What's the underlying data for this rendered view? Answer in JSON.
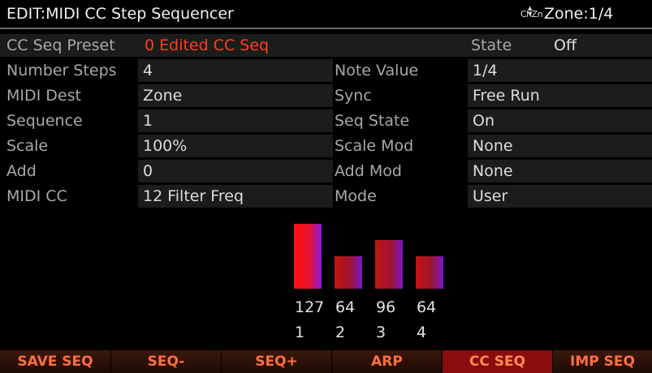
{
  "header": {
    "title": "EDIT:MIDI CC Step Sequencer",
    "channel_zone_icon_text": "ChZn",
    "zone": "Zone:1/4"
  },
  "params": {
    "preset_label": "CC Seq Preset",
    "preset_value": "0 Edited CC Seq",
    "state_label": "State",
    "state_value": "Off",
    "left": [
      {
        "label": "Number Steps",
        "value": "4"
      },
      {
        "label": "MIDI Dest",
        "value": "Zone"
      },
      {
        "label": "Sequence",
        "value": "1"
      },
      {
        "label": "Scale",
        "value": "100%"
      },
      {
        "label": "Add",
        "value": "0"
      },
      {
        "label": "MIDI CC",
        "value": "12 Filter Freq"
      }
    ],
    "right": [
      {
        "label": "Note Value",
        "value": "1/4"
      },
      {
        "label": "Sync",
        "value": "Free Run"
      },
      {
        "label": "Seq State",
        "value": "On"
      },
      {
        "label": "Scale Mod",
        "value": "None"
      },
      {
        "label": "Add Mod",
        "value": "None"
      },
      {
        "label": "Mode",
        "value": "User"
      }
    ]
  },
  "chart_data": {
    "type": "bar",
    "categories": [
      "1",
      "2",
      "3",
      "4"
    ],
    "values": [
      127,
      64,
      96,
      64
    ],
    "value_labels": [
      "127",
      "64",
      "96",
      "64"
    ],
    "ylim": [
      0,
      127
    ],
    "selected_step": 1,
    "colors": {
      "selected": "#ff1010",
      "step": "#c41414",
      "accent": "#8a17e0"
    }
  },
  "softkeys": [
    {
      "label": "SAVE SEQ",
      "active": false
    },
    {
      "label": "SEQ-",
      "active": false
    },
    {
      "label": "SEQ+",
      "active": false
    },
    {
      "label": "ARP",
      "active": false
    },
    {
      "label": "CC SEQ",
      "active": true
    },
    {
      "label": "IMP SEQ",
      "active": false
    }
  ]
}
